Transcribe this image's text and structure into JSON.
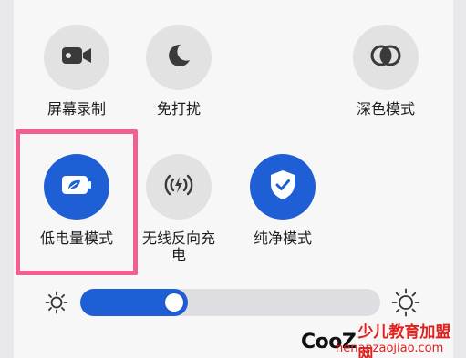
{
  "tiles": [
    {
      "label": "屏幕录制",
      "icon": "video-camera-icon",
      "active": false
    },
    {
      "label": "免打扰",
      "icon": "moon-icon",
      "active": false
    },
    {
      "label": "深色模式",
      "icon": "dark-mode-icon",
      "active": false
    },
    {
      "label": "低电量模式",
      "icon": "battery-leaf-icon",
      "active": true
    },
    {
      "label": "无线反向充\n电",
      "icon": "wireless-charge-icon",
      "active": false
    },
    {
      "label": "纯净模式",
      "icon": "shield-check-icon",
      "active": true
    }
  ],
  "brightness": {
    "level": 0.36
  },
  "colors": {
    "accent": "#1f5fd6",
    "highlight": "#f0608f",
    "tile_bg": "#e2e2e2"
  },
  "watermark": {
    "brand": "CooZ",
    "brand_cn": "少儿教育加盟网",
    "url": "henanzaojiao.com"
  }
}
